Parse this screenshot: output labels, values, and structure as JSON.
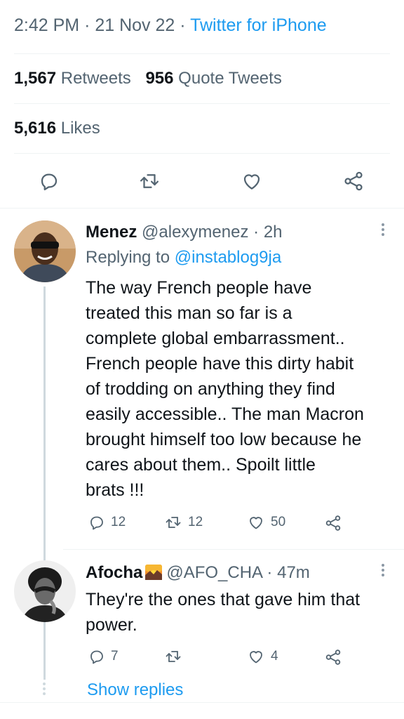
{
  "tweet_meta": {
    "time": "2:42 PM",
    "date": "21 Nov 22",
    "source": "Twitter for iPhone",
    "sep": "·"
  },
  "stats": {
    "retweets_count": "1,567",
    "retweets_label": "Retweets",
    "quotes_count": "956",
    "quotes_label": "Quote Tweets",
    "likes_count": "5,616",
    "likes_label": "Likes"
  },
  "actions": [
    {
      "icon": "reply-icon"
    },
    {
      "icon": "retweet-icon"
    },
    {
      "icon": "like-icon"
    },
    {
      "icon": "share-icon"
    }
  ],
  "replies": [
    {
      "name": "Menez",
      "handle": "@alexymenez",
      "sep": "·",
      "time": "2h",
      "replying_prefix": "Replying to",
      "replying_to": "@instablog9ja",
      "text_lines": [
        "The way French people have",
        "treated this man so far is a",
        "complete global embarrassment..",
        "French people have this dirty habit",
        "of trodding on anything they find",
        "easily accessible.. The man Macron",
        "brought himself too low because he",
        "cares about them.. Spoilt little",
        "brats !!!"
      ],
      "reply_count": "12",
      "retweet_count": "12",
      "like_count": "50"
    },
    {
      "name": "Afocha",
      "name_emoji": "sunset-emoji",
      "handle": "@AFO_CHA",
      "sep": "·",
      "time": "47m",
      "text_lines": [
        "They're the ones that gave him that",
        "power."
      ],
      "reply_count": "7",
      "retweet_count": "",
      "like_count": "4"
    }
  ],
  "show_replies": "Show replies",
  "colors": {
    "link": "#1d9bf0",
    "muted": "#536471",
    "text": "#0f1419",
    "divider": "#eff3f4"
  }
}
